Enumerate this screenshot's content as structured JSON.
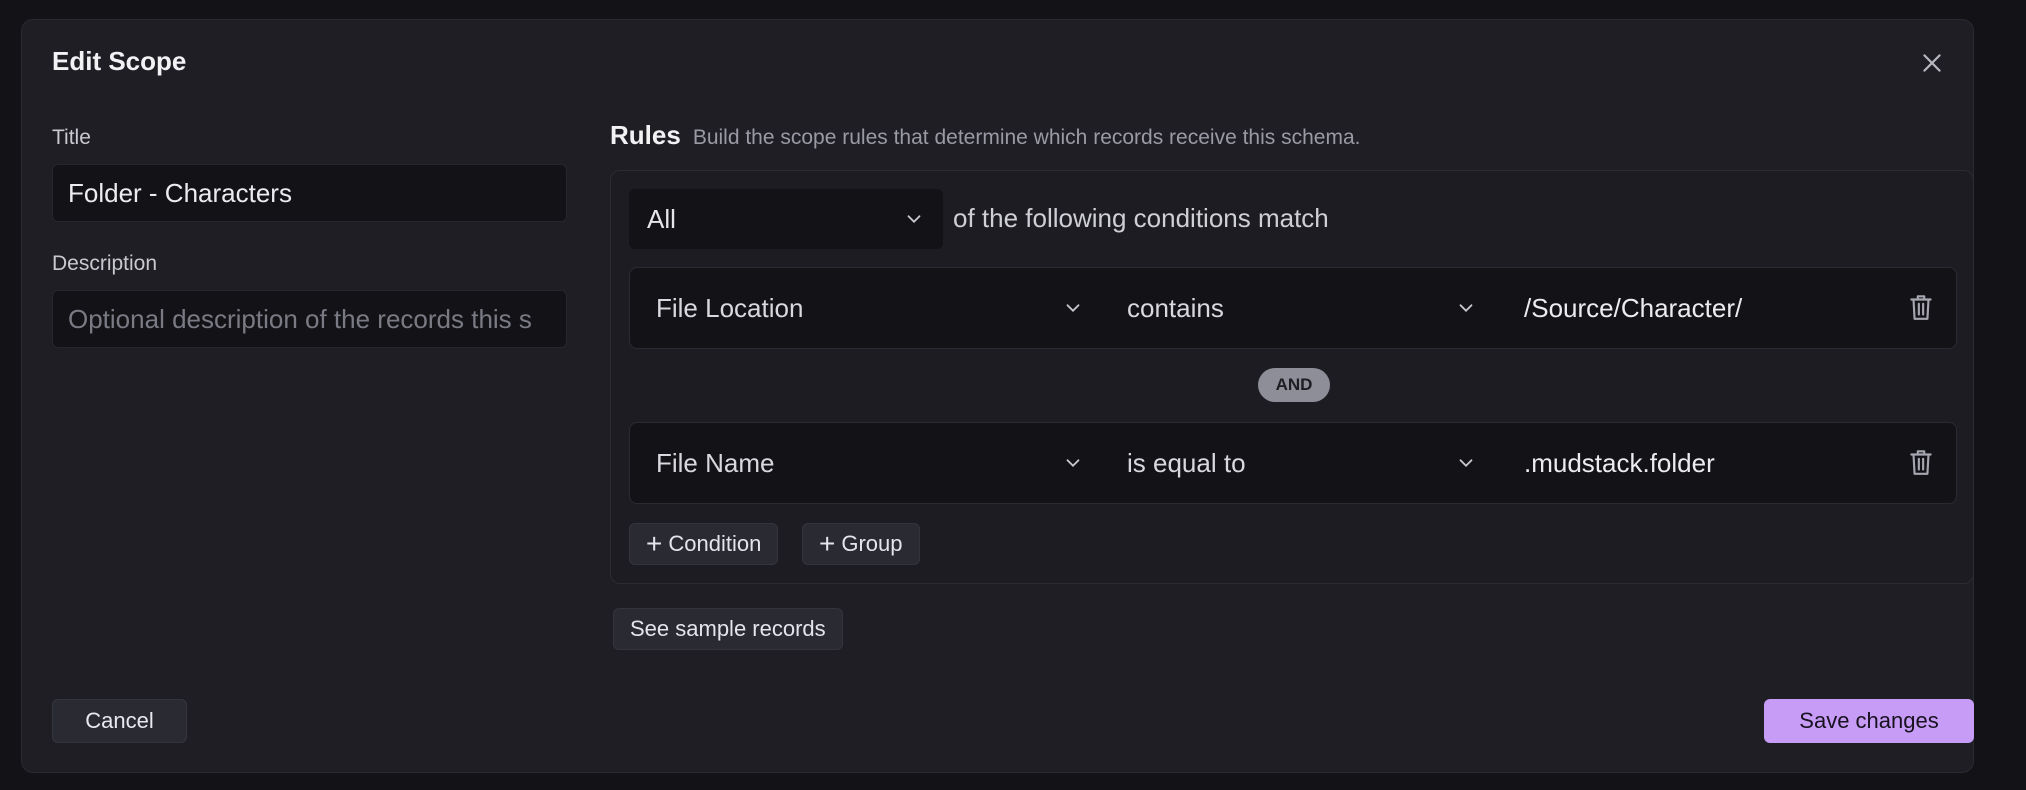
{
  "dialog": {
    "title": "Edit Scope"
  },
  "form": {
    "title_label": "Title",
    "title_value": "Folder - Characters",
    "description_label": "Description",
    "description_placeholder": "Optional description of the records this s"
  },
  "rules": {
    "heading": "Rules",
    "subtitle": "Build the scope rules that determine which records receive this schema.",
    "match_mode": "All",
    "match_text": "of the following conditions match",
    "conditions": [
      {
        "field": "File Location",
        "operator": "contains",
        "value": "/Source/Character/"
      },
      {
        "field": "File Name",
        "operator": "is equal to",
        "value": ".mudstack.folder"
      }
    ],
    "joiner": "AND",
    "add_condition_label": "Condition",
    "add_group_label": "Group",
    "sample_records_label": "See sample records"
  },
  "footer": {
    "cancel_label": "Cancel",
    "save_label": "Save changes"
  },
  "colors": {
    "accent": "#c79cf7",
    "background": "#1e1e24"
  }
}
